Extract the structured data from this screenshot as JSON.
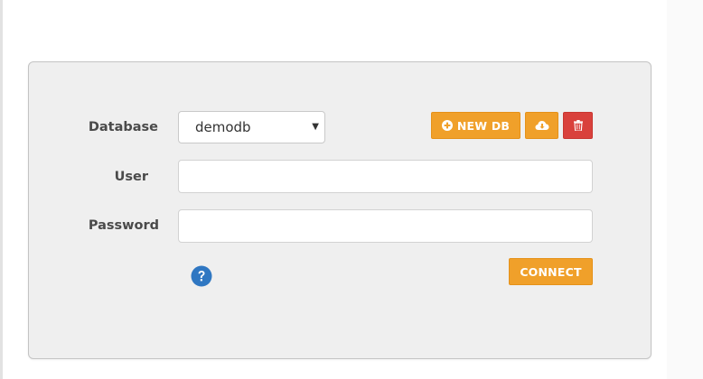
{
  "form": {
    "database": {
      "label": "Database",
      "selected": "demodb"
    },
    "user": {
      "label": "User",
      "value": "",
      "placeholder": ""
    },
    "password": {
      "label": "Password",
      "value": "",
      "placeholder": ""
    }
  },
  "actions": {
    "new_db_label": "NEW DB",
    "connect_label": "CONNECT",
    "download_icon": "cloud-download-icon",
    "delete_icon": "trash-icon",
    "help_icon": "question-circle-icon"
  },
  "colors": {
    "panel_background": "#efefef",
    "accent_orange": "#f0a02a",
    "danger_red": "#d9413c",
    "help_blue": "#2f77c2",
    "label_text": "#4a4a4a"
  }
}
